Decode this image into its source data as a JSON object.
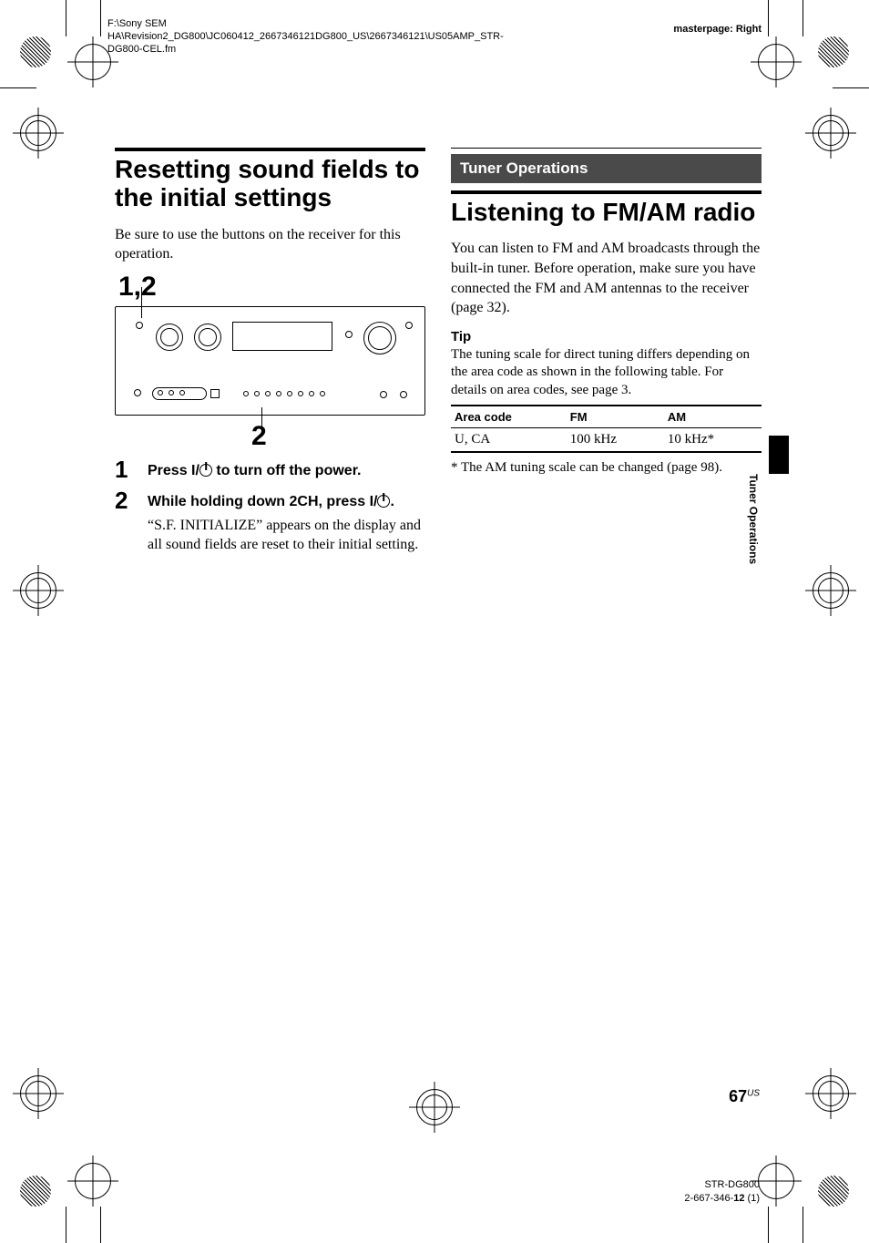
{
  "meta": {
    "path": "F:\\Sony SEM HA\\Revision2_DG800\\JC060412_2667346121DG800_US\\2667346121\\US05AMP_STR-DG800-CEL.fm",
    "masterpage": "masterpage: Right"
  },
  "left": {
    "title": "Resetting sound fields to the initial settings",
    "intro": "Be sure to use the buttons on the receiver for this operation.",
    "callout_top": "1,2",
    "callout_bottom": "2",
    "steps": [
      {
        "num": "1",
        "bold_before": "Press ",
        "bold_after": " to turn off the power."
      },
      {
        "num": "2",
        "bold_before": "While holding down 2CH, press ",
        "bold_after": ".",
        "detail": "“S.F. INITIALIZE” appears on the display and all sound fields are reset to their initial setting."
      }
    ],
    "power_prefix": "I/"
  },
  "right": {
    "chapter": "Tuner Operations",
    "title": "Listening to FM/AM radio",
    "intro": "You can listen to FM and AM broadcasts through the built-in tuner. Before operation, make sure you have connected the FM and AM antennas to the receiver (page 32).",
    "tip_label": "Tip",
    "tip_body": "The tuning scale for direct tuning differs depending on the area code as shown in the following table. For details on area codes, see page 3.",
    "table": {
      "headers": [
        "Area code",
        "FM",
        "AM"
      ],
      "row": [
        "U, CA",
        "100 kHz",
        "10 kHz*"
      ]
    },
    "note": "* The AM tuning scale can be changed (page 98)."
  },
  "sidetab": "Tuner Operations",
  "footer": {
    "page_num": "67",
    "page_suffix": "US",
    "model": "STR-DG800",
    "docnum_pre": "2-667-346-",
    "docnum_bold": "12",
    "docnum_post": " (1)"
  }
}
